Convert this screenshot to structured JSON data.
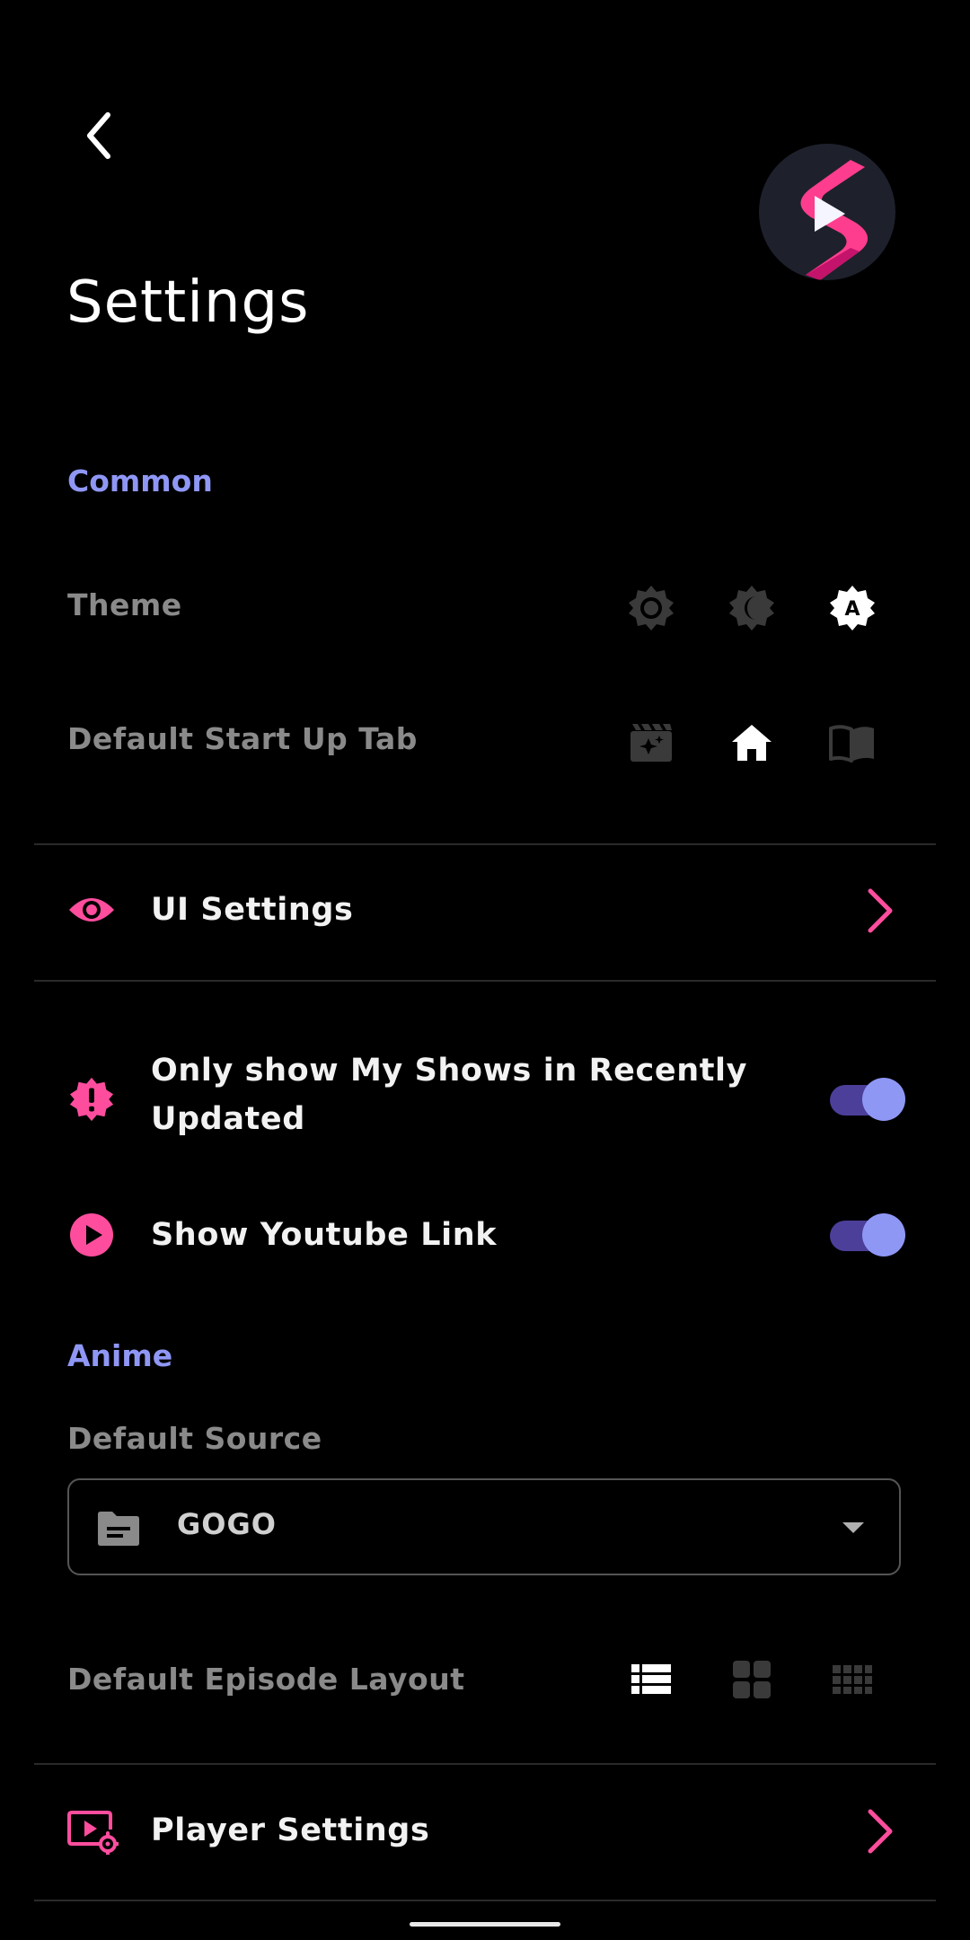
{
  "header": {
    "title": "Settings"
  },
  "common": {
    "section_label": "Common",
    "theme": {
      "label": "Theme",
      "options": [
        "light-theme-icon",
        "dark-theme-icon",
        "auto-theme-icon"
      ],
      "selected": "auto",
      "auto_letter": "A"
    },
    "startup_tab": {
      "label": "Default Start Up Tab",
      "options": [
        "anime-tab-icon",
        "home-tab-icon",
        "manga-tab-icon"
      ],
      "selected": "home"
    },
    "ui_settings": {
      "label": "UI Settings"
    },
    "recently_updated": {
      "label_line1": "Only show My Shows in Recently",
      "label_line2": "Updated",
      "enabled": true
    },
    "youtube_link": {
      "label": "Show Youtube Link",
      "enabled": true
    }
  },
  "anime": {
    "section_label": "Anime",
    "default_source": {
      "label": "Default Source",
      "value": "GOGO"
    },
    "episode_layout": {
      "label": "Default Episode Layout",
      "options": [
        "list-layout-icon",
        "grid-layout-icon",
        "compact-layout-icon"
      ],
      "selected": "list"
    },
    "player_settings": {
      "label": "Player Settings"
    }
  },
  "colors": {
    "accent_pink": "#ff4d9e",
    "accent_purple": "#8f97f5",
    "toggle_track": "#4b3f9a",
    "muted": "#8a8a8a"
  }
}
